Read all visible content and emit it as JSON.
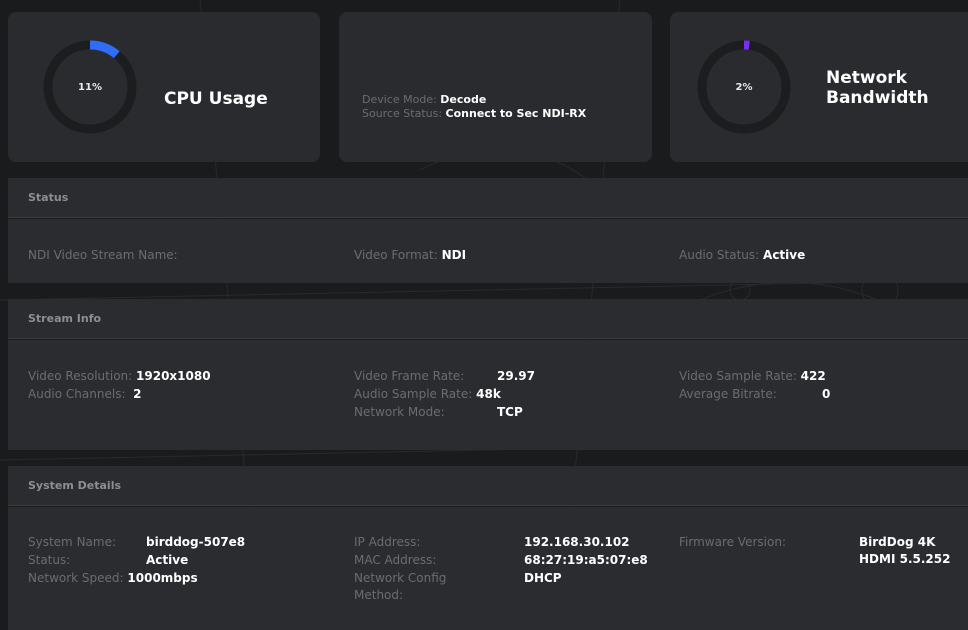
{
  "cpu": {
    "percent": 11,
    "percent_label": "11%",
    "title": "CPU Usage",
    "arc_color": "#2f6df6"
  },
  "device": {
    "mode_label": "Device Mode:",
    "mode_value": "Decode",
    "source_label": "Source Status:",
    "source_value": "Connect to Sec NDI-RX"
  },
  "network": {
    "percent": 2,
    "percent_label": "2%",
    "title_line1": "Network",
    "title_line2": "Bandwidth",
    "arc_color": "#7a2cf0"
  },
  "status": {
    "heading": "Status",
    "ndi_label": "NDI Video Stream Name:",
    "ndi_value": "",
    "format_label": "Video Format:",
    "format_value": "NDI",
    "audio_label": "Audio Status:",
    "audio_value": "Active"
  },
  "stream": {
    "heading": "Stream Info",
    "resolution_label": "Video Resolution:",
    "resolution_value": "1920x1080",
    "channels_label": "Audio Channels:",
    "channels_value": "2",
    "framerate_label": "Video Frame Rate:",
    "framerate_value": "29.97",
    "audiorate_label": "Audio Sample Rate:",
    "audiorate_value": "48k",
    "netmode_label": "Network Mode:",
    "netmode_value": "TCP",
    "samplerate_label": "Video Sample Rate:",
    "samplerate_value": "422",
    "bitrate_label": "Average Bitrate:",
    "bitrate_value": "0"
  },
  "system": {
    "heading": "System Details",
    "name_label": "System Name:",
    "name_value": "birddog-507e8",
    "status_label": "Status:",
    "status_value": "Active",
    "speed_label": "Network Speed:",
    "speed_value": "1000mbps",
    "ip_label": "IP Address:",
    "ip_value": "192.168.30.102",
    "mac_label": "MAC Address:",
    "mac_value": "68:27:19:a5:07:e8",
    "config_label_1": "Network Config",
    "config_label_2": "Method:",
    "config_value": "DHCP",
    "firmware_label": "Firmware Version:",
    "firmware_value_1": "BirdDog 4K",
    "firmware_value_2": "HDMI 5.5.252"
  }
}
